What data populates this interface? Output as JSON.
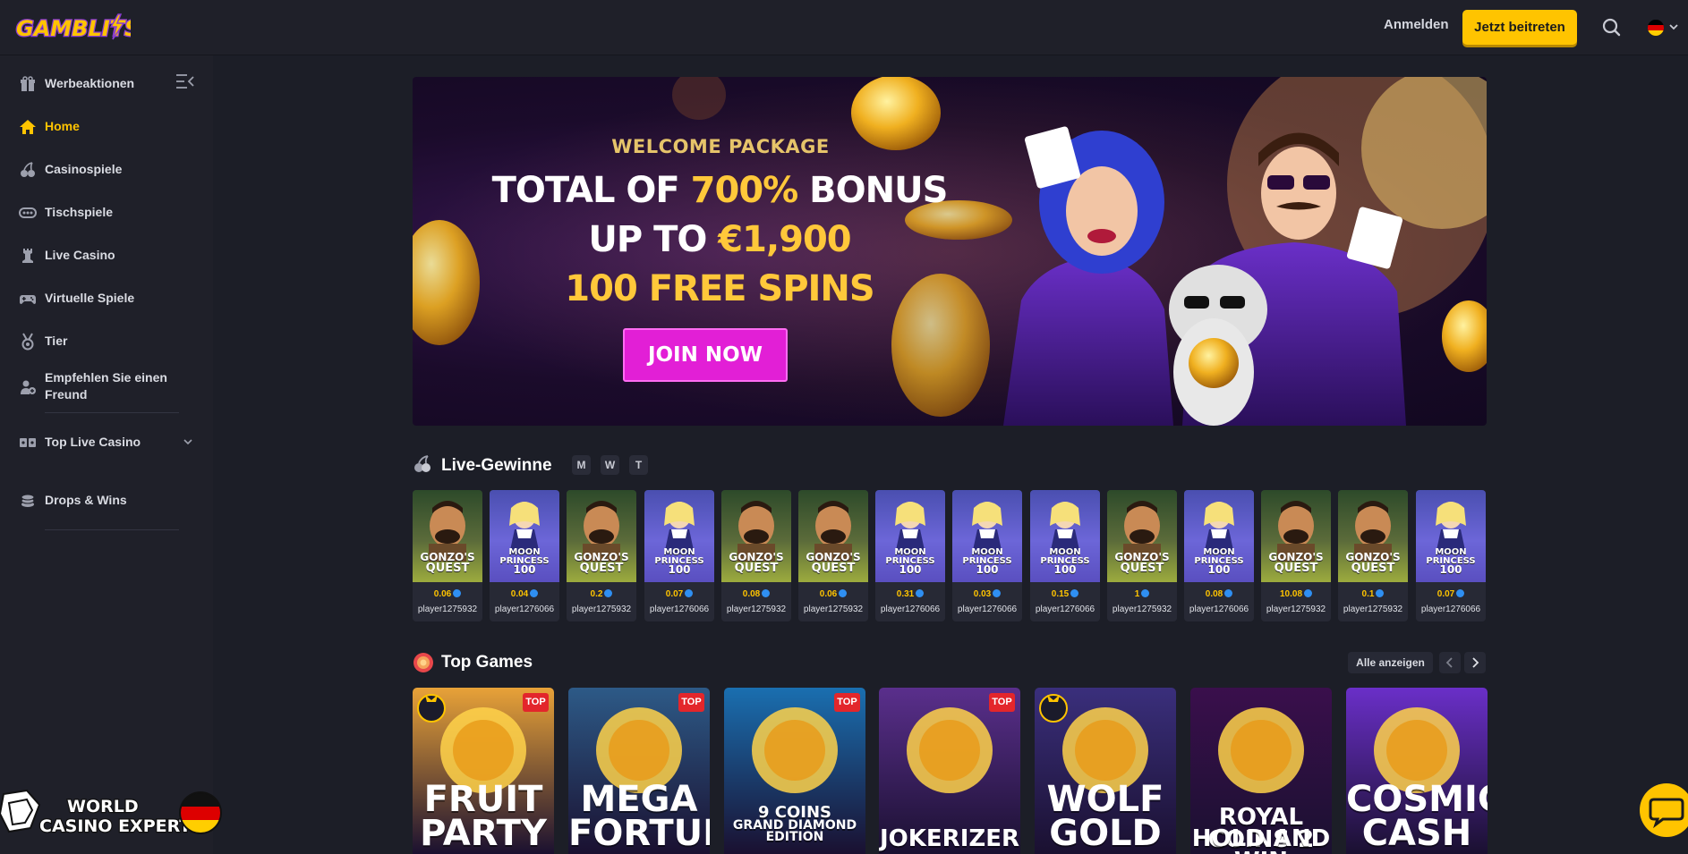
{
  "header": {
    "logo_text": "GAMBLITS",
    "login_label": "Anmelden",
    "join_label": "Jetzt beitreten",
    "language": "de"
  },
  "sidebar": {
    "items": [
      {
        "label": "Werbeaktionen",
        "icon": "gift-icon"
      },
      {
        "label": "Home",
        "icon": "home-icon",
        "active": true
      },
      {
        "label": "Casinospiele",
        "icon": "cherry-icon"
      },
      {
        "label": "Tischspiele",
        "icon": "table-games-icon"
      },
      {
        "label": "Live Casino",
        "icon": "chess-rook-icon"
      },
      {
        "label": "Virtuelle Spiele",
        "icon": "gamepad-icon"
      },
      {
        "label": "Tier",
        "icon": "medal-icon"
      },
      {
        "label": "Empfehlen Sie einen Freund",
        "icon": "refer-friend-icon"
      },
      {
        "label": "Top Live Casino",
        "icon": "cards-icon"
      },
      {
        "label": "Drops & Wins",
        "icon": "coins-icon"
      }
    ]
  },
  "banner": {
    "welcome": "WELCOME PACKAGE",
    "line1_pre": "TOTAL OF ",
    "line1_highlight": "700%",
    "line1_post": " BONUS",
    "line2_pre": "UP TO ",
    "line2_highlight": "€1,900",
    "line3": "100 FREE SPINS",
    "cta": "JOIN NOW"
  },
  "live_wins": {
    "title": "Live-Gewinne",
    "filters": [
      "M",
      "W",
      "T"
    ],
    "cards": [
      {
        "game": "gonzo",
        "amount": "0.06",
        "player": "player1275932"
      },
      {
        "game": "moon",
        "amount": "0.04",
        "player": "player1276066"
      },
      {
        "game": "gonzo",
        "amount": "0.2",
        "player": "player1275932"
      },
      {
        "game": "moon",
        "amount": "0.07",
        "player": "player1276066"
      },
      {
        "game": "gonzo",
        "amount": "0.08",
        "player": "player1275932"
      },
      {
        "game": "gonzo",
        "amount": "0.06",
        "player": "player1275932"
      },
      {
        "game": "moon",
        "amount": "0.31",
        "player": "player1276066"
      },
      {
        "game": "moon",
        "amount": "0.03",
        "player": "player1276066"
      },
      {
        "game": "moon",
        "amount": "0.15",
        "player": "player1276066"
      },
      {
        "game": "gonzo",
        "amount": "1",
        "player": "player1275932"
      },
      {
        "game": "moon",
        "amount": "0.08",
        "player": "player1276066"
      },
      {
        "game": "gonzo",
        "amount": "10.08",
        "player": "player1275932"
      },
      {
        "game": "gonzo",
        "amount": "0.1",
        "player": "player1275932"
      },
      {
        "game": "moon",
        "amount": "0.07",
        "player": "player1276066"
      }
    ],
    "gonzo_title": [
      "GONZO'S",
      "QUEST"
    ],
    "moon_title": [
      "MOON",
      "PRINCESS",
      "100"
    ]
  },
  "top_games": {
    "title": "Top Games",
    "view_all": "Alle anzeigen",
    "top_badge": "TOP",
    "games": [
      {
        "title_lines": [
          "FRUIT",
          "PARTY"
        ],
        "top": true,
        "drops": true,
        "bg": "#e8a238"
      },
      {
        "title_lines": [
          "MEGA",
          "FORTUNE"
        ],
        "top": true,
        "drops": false,
        "bg": "#2d5a87"
      },
      {
        "title_lines": [
          "9 COINS",
          "GRAND DIAMOND",
          "EDITION"
        ],
        "top": true,
        "drops": false,
        "bg": "#1a6fb0"
      },
      {
        "title_lines": [
          "JOKERIZER"
        ],
        "top": true,
        "drops": false,
        "bg": "#5a2f8c"
      },
      {
        "title_lines": [
          "WOLF",
          "GOLD"
        ],
        "top": false,
        "drops": true,
        "bg": "#3a2f7c"
      },
      {
        "title_lines": [
          "ROYAL COINS 2",
          "HOLD AND WIN"
        ],
        "top": false,
        "drops": false,
        "bg": "#3a0f4c"
      },
      {
        "title_lines": [
          "COSMIC",
          "CASH"
        ],
        "top": false,
        "drops": false,
        "bg": "#6a2fc8"
      }
    ]
  },
  "watermark": {
    "line1": "WORLD",
    "line2": "CASINO EXPERT"
  }
}
